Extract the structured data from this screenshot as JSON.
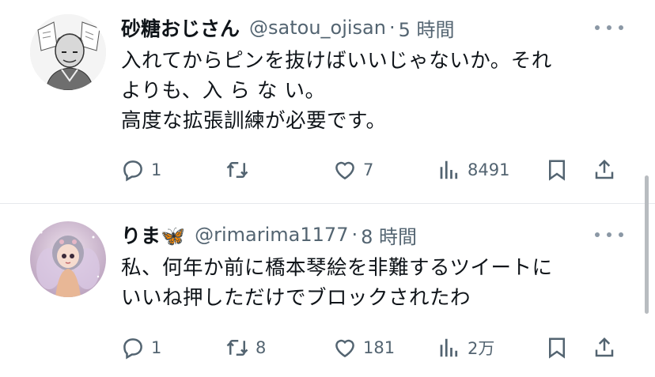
{
  "tweets": [
    {
      "name": "砂糖おじさん",
      "handle": "@satou_ojisan",
      "time": "5 時間",
      "lines": [
        "入れてからピンを抜けばいいじゃないか。それ",
        "よりも、入 ら な い。",
        "高度な拡張訓練が必要です。"
      ],
      "stats": {
        "replies": "1",
        "retweets": "",
        "likes": "7",
        "views": "8491"
      }
    },
    {
      "name": "りま🦋",
      "handle": "@rimarima1177",
      "time": "8 時間",
      "lines": [
        "私、何年か前に橋本琴絵を非難するツイートに",
        "いいね押しただけでブロックされたわ"
      ],
      "stats": {
        "replies": "1",
        "retweets": "8",
        "likes": "181",
        "views": "2万"
      }
    }
  ],
  "icons": [
    "reply-icon",
    "retweet-icon",
    "heart-icon",
    "views-icon",
    "bookmark-icon",
    "share-icon",
    "more-icon"
  ],
  "colors": {
    "text": "#0f1419",
    "secondary": "#536471",
    "divider": "#e6e9ec"
  }
}
